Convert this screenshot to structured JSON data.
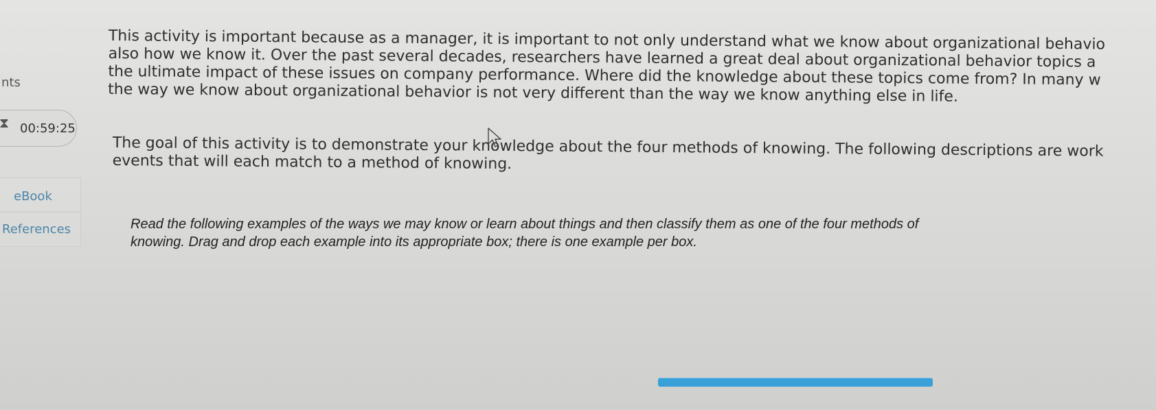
{
  "sidebar": {
    "points_label": "nts",
    "timer": "00:59:25",
    "ebook_label": "eBook",
    "references_label": "References",
    "timer_icon": "hourglass-icon"
  },
  "main": {
    "intro_lines": [
      "This activity is important because as a manager, it is important to not only understand what we know about organizational behavio",
      "also how we know it. Over the past several decades, researchers have learned a great deal about organizational behavior topics a",
      "the ultimate impact of these issues on company performance. Where did the knowledge about these topics come from? In many w",
      "the way we know about organizational behavior is not very different than the way we know anything else in life."
    ],
    "goal_lines": [
      "The goal of this activity is to demonstrate your knowledge about the four methods of knowing. The following descriptions are work",
      "events that will each match to a method of knowing."
    ],
    "instructions": "Read the following examples of the ways we may know or learn about things and then classify them as one of the four methods of knowing. Drag and drop each example into its appropriate box; there is one example per box."
  },
  "colors": {
    "background": "#dcdcda",
    "link": "#4b86a8",
    "progress_bar": "#3aa0d8"
  }
}
